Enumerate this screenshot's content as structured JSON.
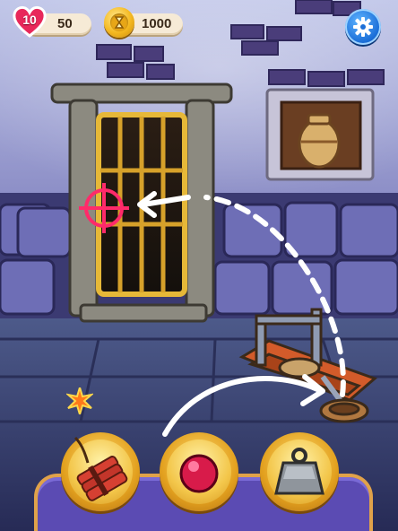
{
  "hud": {
    "level": "10",
    "lives": "50",
    "coins": "1000",
    "settings_icon": "gear-icon"
  },
  "scene": {
    "objects": [
      "prison-door",
      "vase-painting",
      "catapult",
      "target-crosshair"
    ]
  },
  "inventory": {
    "items": [
      {
        "name": "dynamite",
        "icon": "dynamite-icon"
      },
      {
        "name": "red-ball",
        "icon": "red-ball-icon"
      },
      {
        "name": "weight",
        "icon": "weight-icon"
      }
    ]
  },
  "colors": {
    "tray": "#5b4bb3",
    "slot_gold": "#f3c64a",
    "target": "#ff2a6a",
    "wall": "#3b3a72"
  }
}
